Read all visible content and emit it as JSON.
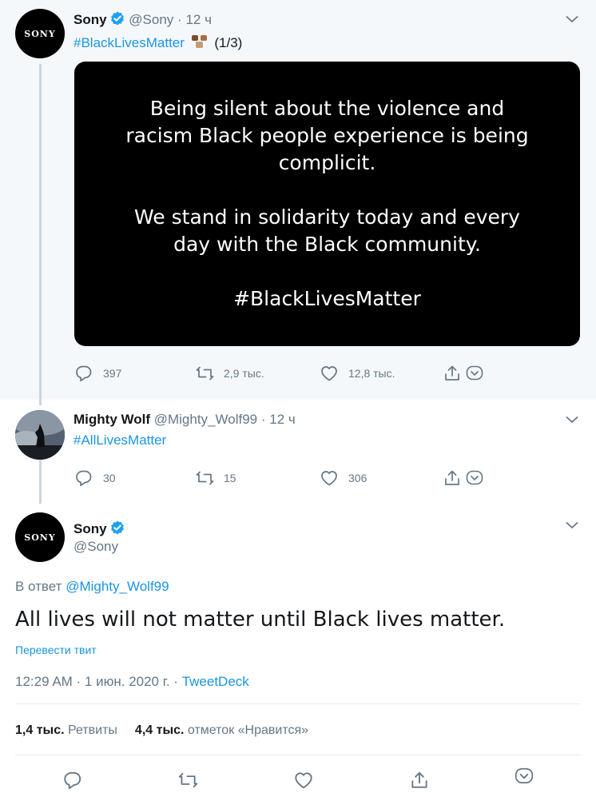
{
  "tweet1": {
    "author_name": "Sony",
    "handle": "@Sony",
    "sep": "·",
    "time": "12 ч",
    "hashtag": "#BlackLivesMatter",
    "counter": "(1/3)",
    "avatar_text": "SONY",
    "image_lines_1": [
      "Being silent about the violence and",
      "racism Black people experience is being",
      "complicit."
    ],
    "image_lines_2": [
      "We stand in solidarity today and every",
      "day with the Black community."
    ],
    "image_line_3": "#BlackLivesMatter",
    "replies": "397",
    "retweets": "2,9 тыс.",
    "likes": "12,8 тыс."
  },
  "tweet2": {
    "author_name": "Mighty Wolf",
    "handle": "@Mighty_Wolf99",
    "sep": "·",
    "time": "12 ч",
    "hashtag": "#AllLivesMatter",
    "replies": "30",
    "retweets": "15",
    "likes": "306"
  },
  "tweet3": {
    "author_name": "Sony",
    "handle": "@Sony",
    "avatar_text": "SONY",
    "reply_prefix": "В ответ",
    "reply_handle": "@Mighty_Wolf99",
    "text": "All lives will not matter until Black lives matter.",
    "translate": "Перевести твит",
    "timestamp": "12:29 AM · 1 июн. 2020 г. ·",
    "source": "TweetDeck",
    "retweet_count": "1,4 тыс.",
    "retweet_label": "Ретвиты",
    "like_count": "4,4 тыс.",
    "like_label": "отметок «Нравится»"
  },
  "colors": {
    "accent": "#1b95e0",
    "muted": "#657786",
    "thread_bg": "#f5f8fa"
  }
}
